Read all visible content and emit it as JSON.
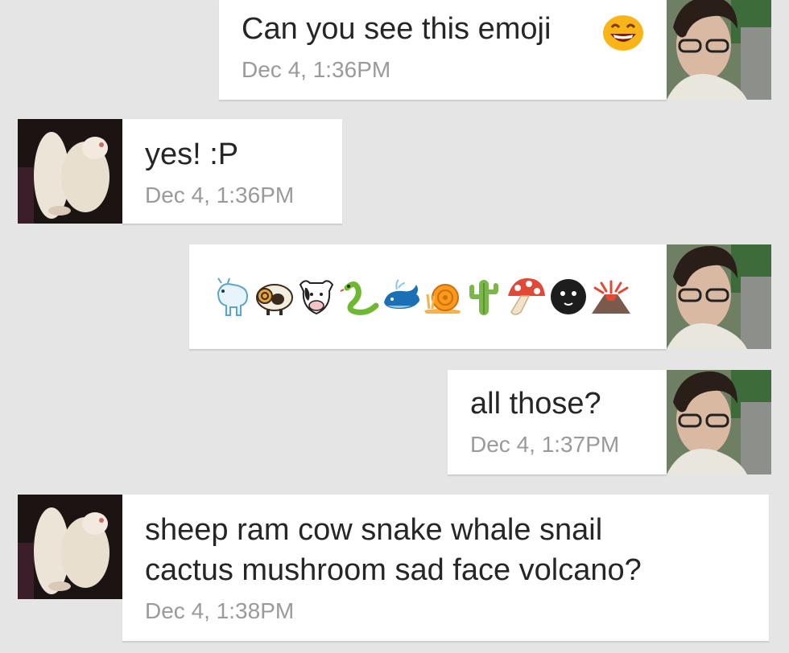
{
  "messages": [
    {
      "id": 1,
      "side": "sent",
      "text": "Can you see this emoji",
      "time": "Dec 4, 1:36PM",
      "emoji": "grinning-face-icon"
    },
    {
      "id": 2,
      "side": "received",
      "text": "yes! :P",
      "time": "Dec 4, 1:36PM"
    },
    {
      "id": 3,
      "side": "sent",
      "emoji_sequence": [
        "goat-icon",
        "ram-icon",
        "cow-icon",
        "snake-icon",
        "whale-icon",
        "snail-icon",
        "cactus-icon",
        "mushroom-icon",
        "new-moon-face-icon",
        "volcano-icon"
      ]
    },
    {
      "id": 4,
      "side": "sent",
      "text": "all those?",
      "time": "Dec 4, 1:37PM"
    },
    {
      "id": 5,
      "side": "received",
      "text_line1": "sheep ram cow snake whale snail",
      "text_line2": "cactus mushroom sad face volcano?",
      "time": "Dec 4, 1:38PM"
    }
  ],
  "colors": {
    "background": "#e5e5e5",
    "bubble": "#ffffff",
    "timestamp": "#9a9a9a",
    "text": "#262626"
  }
}
